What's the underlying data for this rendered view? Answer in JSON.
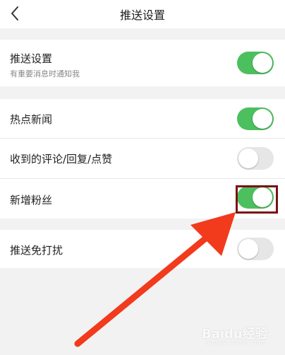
{
  "header": {
    "title": "推送设置"
  },
  "groups": [
    {
      "rows": [
        {
          "label": "推送设置",
          "sub": "有重要消息时通知我",
          "toggle": true
        }
      ]
    },
    {
      "rows": [
        {
          "label": "热点新闻",
          "toggle": true
        },
        {
          "label": "收到的评论/回复/点赞",
          "toggle": false
        },
        {
          "label": "新增粉丝",
          "toggle": true
        }
      ]
    },
    {
      "rows": [
        {
          "label": "推送免打扰",
          "toggle": false
        }
      ]
    }
  ],
  "colors": {
    "accent": "#4cbf5f",
    "toggle_off": "#e6e6e6",
    "arrow": "#f23a1c",
    "highlight": "#7a1111"
  },
  "watermark": {
    "text": "Baidu经验",
    "sub": "jingyan.baidu.com"
  }
}
